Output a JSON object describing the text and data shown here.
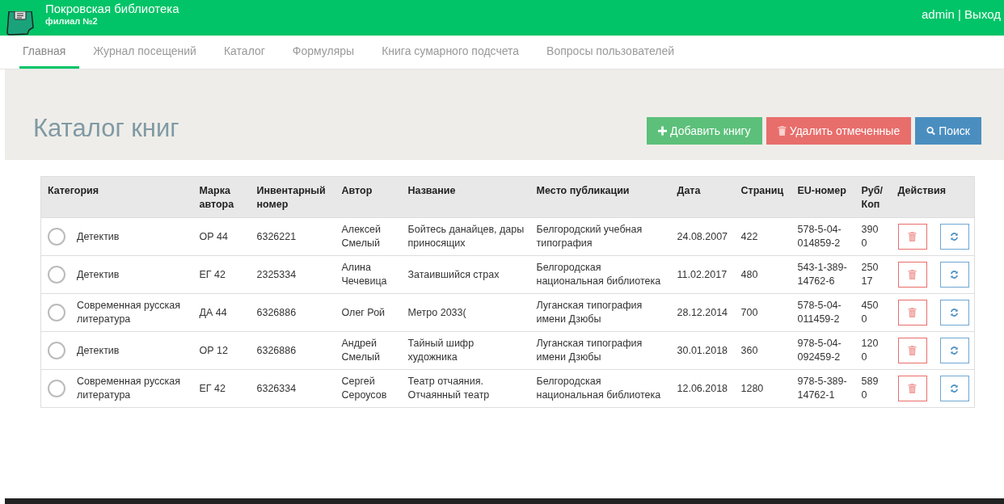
{
  "header": {
    "title": "Покровская библиотека",
    "subtitle": "филиал №2",
    "user": "admin | Выход"
  },
  "tabs": [
    {
      "label": "Главная",
      "selected": true
    },
    {
      "label": "Журнал посещений",
      "selected": false
    },
    {
      "label": "Каталог",
      "selected": false
    },
    {
      "label": "Формуляры",
      "selected": false
    },
    {
      "label": "Книга сумарного подсчета",
      "selected": false
    },
    {
      "label": "Вопросы пользователей",
      "selected": false
    }
  ],
  "page_title": "Каталог книг",
  "buttons": [
    {
      "kind": "add",
      "label": "Добавить книгу"
    },
    {
      "kind": "delete",
      "label": "Удалить отмеченные"
    },
    {
      "kind": "search",
      "label": "Поиск"
    }
  ],
  "table": {
    "columns": [
      "Категория",
      "Марка автора",
      "Инвентарный номер",
      "Автор",
      "Название",
      "Место публикации",
      "Дата",
      "Страниц",
      "EU-номер",
      "Руб/ Коп",
      "Действия"
    ],
    "rows": [
      {
        "selected": false,
        "cells": [
          "Детектив",
          "ОР 44",
          "6326221",
          "Алексей Смелый",
          "Бойтесь данайцев, дары приносящих",
          "Белгородский учебная типография",
          "24.08.2007",
          "422",
          "578-5-04-014859-2",
          "390 0"
        ]
      },
      {
        "selected": false,
        "cells": [
          "Детектив",
          "ЕГ 42",
          "2325334",
          "Алина Чечевица",
          "Затаившийся страх",
          "Белгородская национальная библиотека",
          "11.02.2017",
          "480",
          "543-1-389-14762-6",
          "250 17"
        ]
      },
      {
        "selected": false,
        "cells": [
          "Современная русская литература",
          "ДА 44",
          "6326886",
          "Олег Рой",
          "Метро 2033(",
          "Луганская типография имени Дзюбы",
          "28.12.2014",
          "700",
          "578-5-04-011459-2",
          "450 0"
        ]
      },
      {
        "selected": false,
        "cells": [
          "Детектив",
          "ОР 12",
          "6326886",
          "Андрей Смелый",
          "Тайный шифр художника",
          "Луганская типография имени Дзюбы",
          "30.01.2018",
          "360",
          "978-5-04-092459-2",
          "120 0"
        ]
      },
      {
        "selected": false,
        "cells": [
          "Современная русская литература",
          "ЕГ 42",
          "6326334",
          "Сергей Сероусов",
          "Театр отчаяния. Отчаянный театр",
          "Белгородская национальная библиотека",
          "12.06.2018",
          "1280",
          "978-5-389-14762-1",
          "589 0"
        ]
      }
    ]
  }
}
